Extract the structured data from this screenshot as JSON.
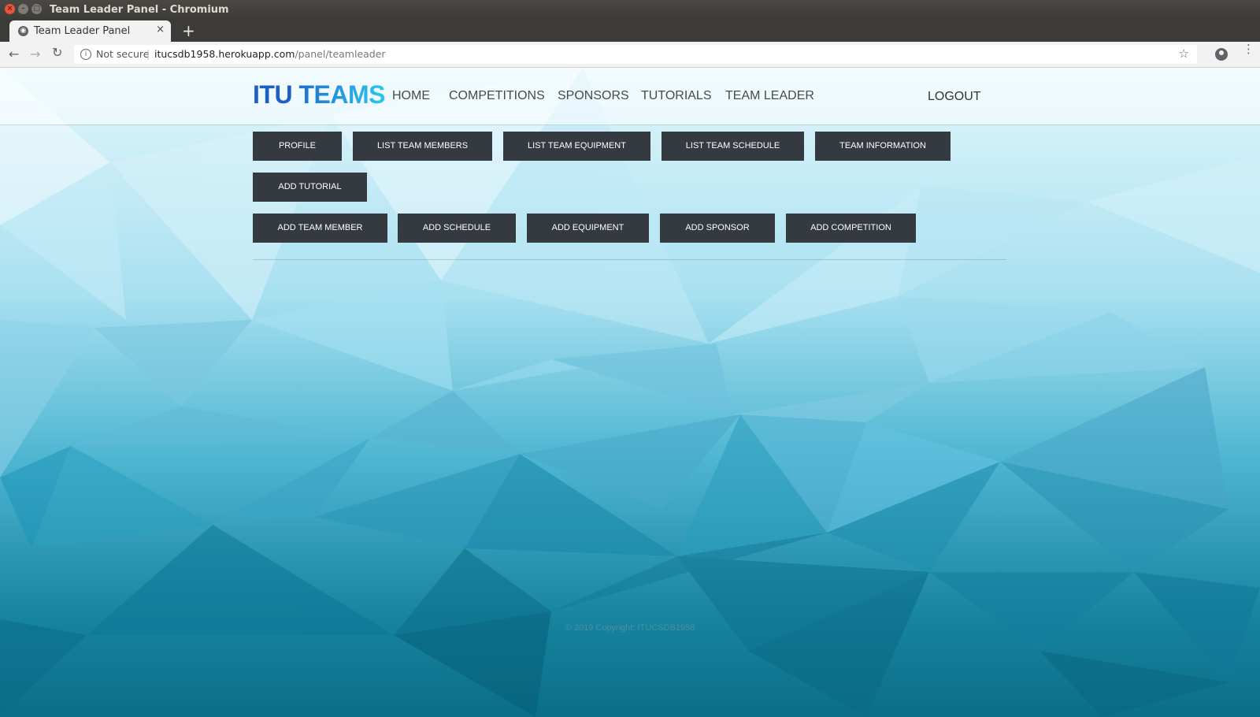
{
  "window": {
    "title": "Team Leader Panel - Chromium"
  },
  "tab": {
    "title": "Team Leader Panel",
    "close": "×",
    "new_tab": "+"
  },
  "toolbar": {
    "security_label": "Not secure",
    "separator": "|",
    "url_host": "itucsdb1958.herokuapp.com",
    "url_path": "/panel/teamleader"
  },
  "site": {
    "logo_itu": "ITU",
    "logo_teams": "TEAMS",
    "nav": [
      "HOME",
      "COMPETITIONS",
      "SPONSORS",
      "TUTORIALS",
      "TEAM LEADER"
    ],
    "logout": "LOGOUT"
  },
  "panel": {
    "row1": [
      "PROFILE",
      "LIST TEAM MEMBERS",
      "LIST TEAM EQUIPMENT",
      "LIST TEAM SCHEDULE",
      "TEAM INFORMATION"
    ],
    "row2": [
      "ADD TUTORIAL"
    ],
    "row3": [
      "ADD TEAM MEMBER",
      "ADD SCHEDULE",
      "ADD EQUIPMENT",
      "ADD SPONSOR",
      "ADD COMPETITION"
    ]
  },
  "footer": {
    "copyright": "© 2019 Copyright: ITUCSDB1958"
  },
  "colors": {
    "button_bg": "#343a40",
    "logo_blue": "#1e5fc6",
    "logo_cyan": "#2ec7e8"
  }
}
